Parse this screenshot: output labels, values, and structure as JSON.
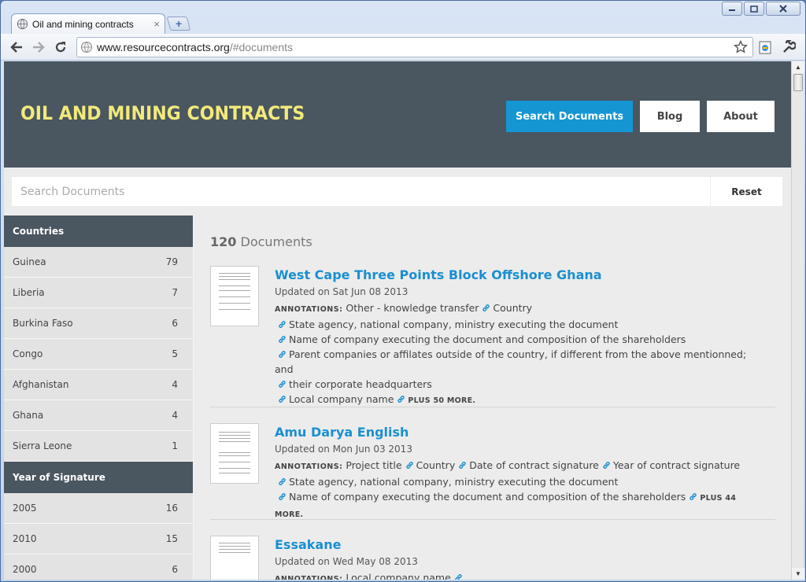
{
  "browser": {
    "tab_title": "Oil and mining contracts",
    "tab_close": "×",
    "new_tab": "+",
    "url_host": "www.resourcecontracts.org",
    "url_path": "/#documents"
  },
  "header": {
    "title": "OIL AND MINING CONTRACTS",
    "nav": [
      "Search Documents",
      "Blog",
      "About"
    ]
  },
  "search": {
    "placeholder": "Search Documents",
    "reset": "Reset"
  },
  "facets": {
    "countries_label": "Countries",
    "countries": [
      {
        "name": "Guinea",
        "count": "79"
      },
      {
        "name": "Liberia",
        "count": "7"
      },
      {
        "name": "Burkina Faso",
        "count": "6"
      },
      {
        "name": "Congo",
        "count": "5"
      },
      {
        "name": "Afghanistan",
        "count": "4"
      },
      {
        "name": "Ghana",
        "count": "4"
      },
      {
        "name": "Sierra Leone",
        "count": "1"
      }
    ],
    "years_label": "Year of Signature",
    "years": [
      {
        "name": "2005",
        "count": "16"
      },
      {
        "name": "2010",
        "count": "15"
      },
      {
        "name": "2000",
        "count": "6"
      }
    ]
  },
  "results": {
    "count": "120",
    "count_suffix": "Documents",
    "annotations_label": "ANNOTATIONS:",
    "documents": [
      {
        "title": "West Cape Three Points Block Offshore Ghana",
        "updated": "Updated on Sat Jun 08 2013",
        "lines": [
          [
            "Other - knowledge transfer",
            "Country"
          ],
          [
            "State agency, national company, ministry executing the document"
          ],
          [
            "Name of company executing the document and composition of the shareholders"
          ],
          [
            "Parent companies or affilates outside of the country, if different from the above mentionned; and"
          ],
          [
            "their corporate headquarters"
          ],
          [
            "Local company name"
          ]
        ],
        "more": "PLUS 50 MORE."
      },
      {
        "title": "Amu Darya English",
        "updated": "Updated on Mon Jun 03 2013",
        "lines": [
          [
            "Project title",
            "Country",
            "Date of contract signature",
            "Year of contract signature"
          ],
          [
            "State agency, national company, ministry executing the document"
          ],
          [
            "Name of company executing the document and composition of the shareholders"
          ]
        ],
        "more": "PLUS 44 MORE."
      },
      {
        "title": "Essakane",
        "updated": "Updated on Wed May 08 2013",
        "lines": [
          [
            "Local company name"
          ]
        ],
        "more": ""
      }
    ]
  }
}
